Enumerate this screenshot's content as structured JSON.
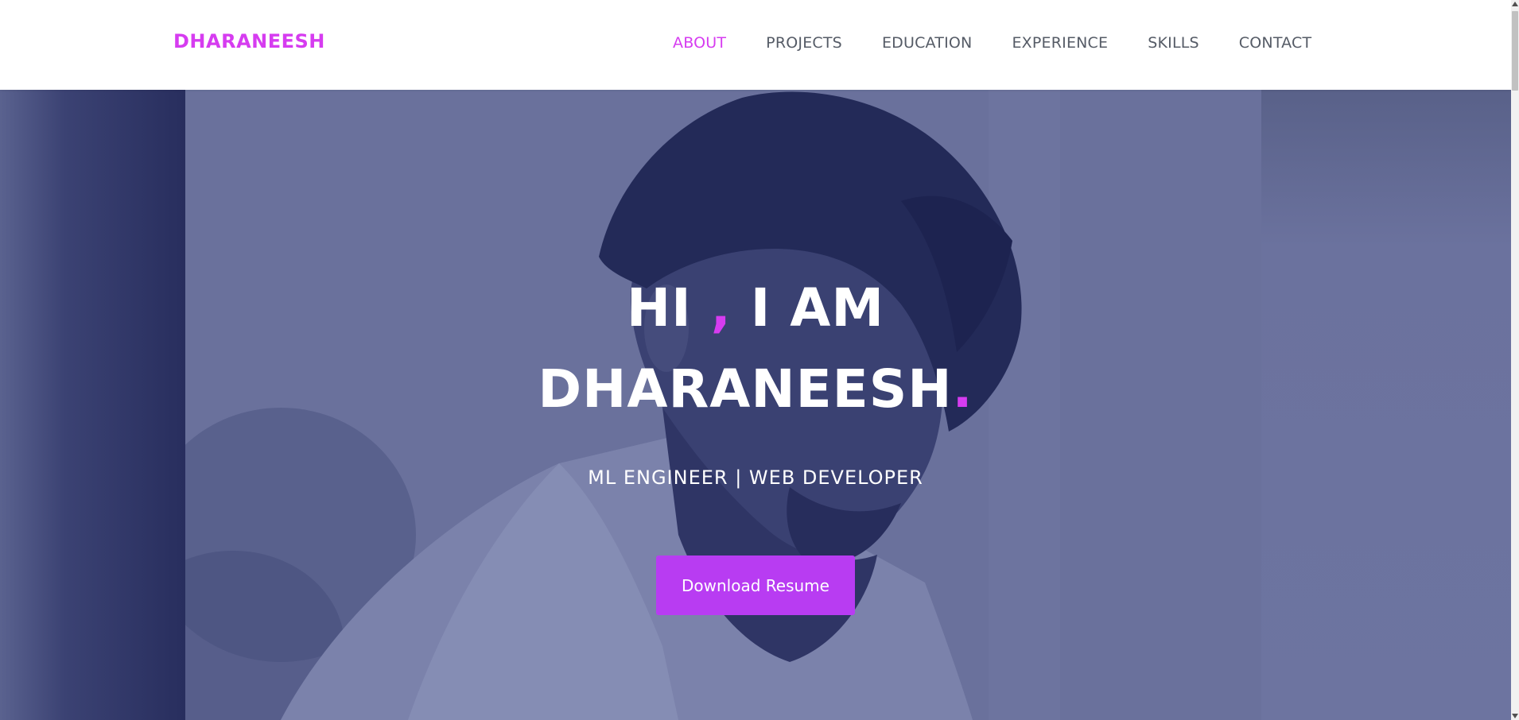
{
  "brand": {
    "name": "DHARANEESH"
  },
  "nav": {
    "items": [
      {
        "label": "ABOUT",
        "active": true
      },
      {
        "label": "PROJECTS",
        "active": false
      },
      {
        "label": "EDUCATION",
        "active": false
      },
      {
        "label": "EXPERIENCE",
        "active": false
      },
      {
        "label": "SKILLS",
        "active": false
      },
      {
        "label": "CONTACT",
        "active": false
      }
    ]
  },
  "hero": {
    "greeting_part1": "HI ",
    "greeting_comma": ",",
    "greeting_part2": " I AM",
    "name": "DHARANEESH",
    "name_dot": ".",
    "subtitle": "ML ENGINEER | WEB DEVELOPER",
    "cta_label": "Download Resume"
  },
  "colors": {
    "accent": "#d63cf0",
    "button": "#b83cf2",
    "nav_text": "#555b66",
    "hero_overlay": "#6a719c"
  }
}
